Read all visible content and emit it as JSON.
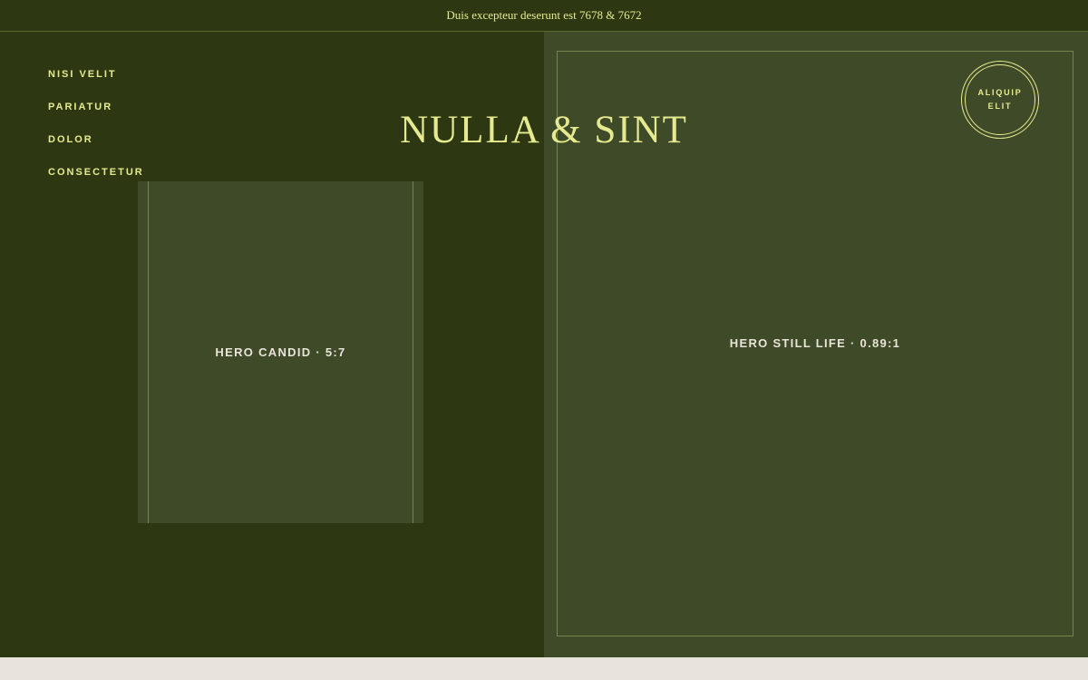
{
  "topbar": {
    "text": "Duis excepteur deserunt est 7678 & 7672"
  },
  "nav": {
    "items": [
      {
        "label": "NISI VELIT"
      },
      {
        "label": "PARIATUR"
      },
      {
        "label": "DOLOR"
      },
      {
        "label": "CONSECTETUR"
      }
    ]
  },
  "logo": {
    "text": "NULLA & SINT"
  },
  "badge": {
    "line1": "ALIQUIP",
    "line2": "ELIT"
  },
  "hero_candid": {
    "caption": "HERO CANDID · 5:7"
  },
  "hero_still": {
    "caption": "HERO STILL LIFE · 0.89:1"
  },
  "colors": {
    "dark_green": "#2d3813",
    "mid_green": "#3f4a29",
    "accent_yellow": "#e6ea8f",
    "footer_beige": "#e8e4db"
  }
}
